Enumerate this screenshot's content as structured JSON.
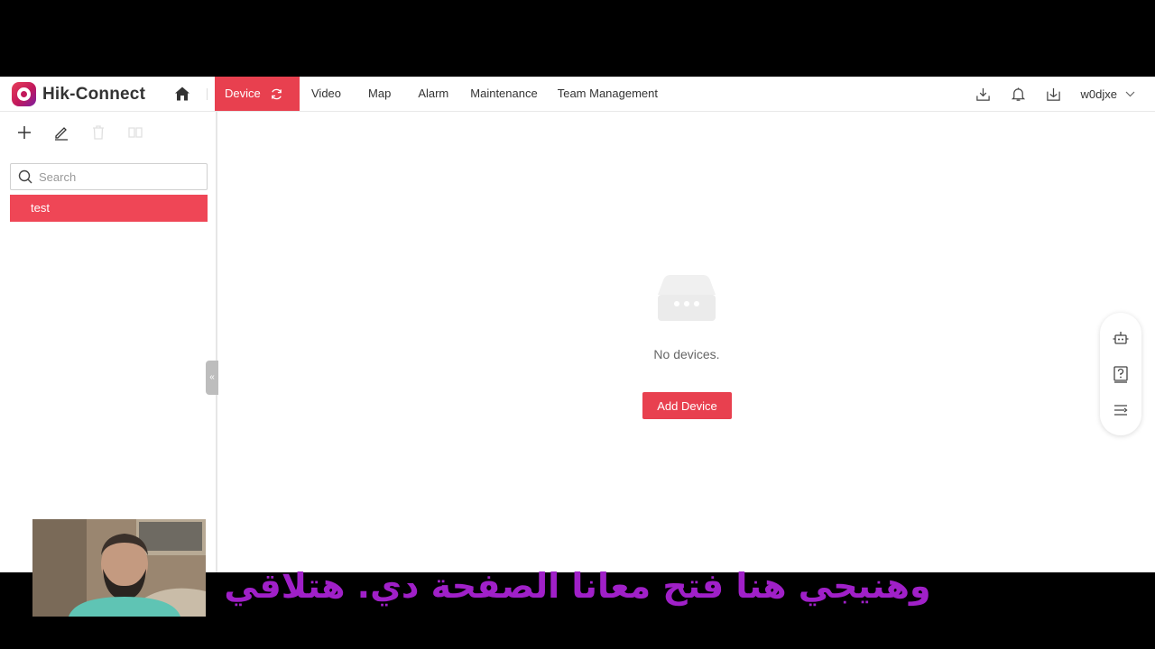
{
  "app": {
    "logo_text": "Hik-Connect"
  },
  "nav": {
    "items": [
      {
        "label": "Device",
        "active": true
      },
      {
        "label": "Video"
      },
      {
        "label": "Map"
      },
      {
        "label": "Alarm"
      },
      {
        "label": "Maintenance"
      },
      {
        "label": "Team Management"
      }
    ]
  },
  "header": {
    "username": "w0djxe",
    "icons": [
      "download-icon",
      "bell-icon",
      "export-icon"
    ]
  },
  "sidebar": {
    "tools": [
      "add-icon",
      "edit-icon",
      "delete-icon",
      "move-icon"
    ],
    "search_placeholder": "Search",
    "groups": [
      {
        "label": "test"
      }
    ]
  },
  "main": {
    "empty_text": "No devices.",
    "add_button": "Add Device"
  },
  "float_panel": {
    "icons": [
      "robot-icon",
      "help-icon",
      "menu-icon"
    ]
  },
  "subtitle": "وهنيجي هنا فتح معانا الصفحة دي. هتلاقي",
  "colors": {
    "accent": "#e8404f",
    "subtitle": "#a020c8"
  }
}
